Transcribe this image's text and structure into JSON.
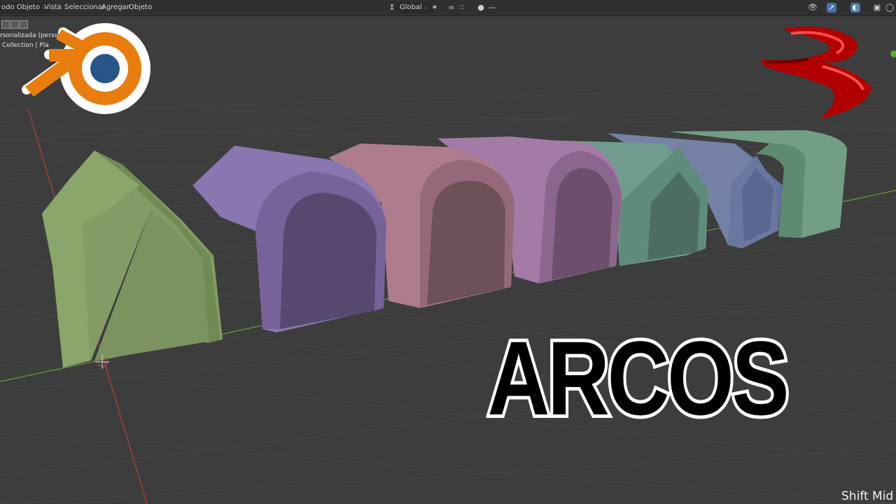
{
  "header": {
    "mode_label": "odo Objeto",
    "menus": [
      "Vista",
      "Seleccionar",
      "Agregar",
      "Objeto"
    ],
    "transform_orientation": "Global"
  },
  "hud": {
    "view_name": "rsonalizada (perso",
    "collection_info": "Collection | Pla"
  },
  "overlay": {
    "title": "ARCOS",
    "shortcut_hint": "Shift Mid"
  },
  "icons": [
    "blender-logo",
    "red-s-logo",
    "eye-icon",
    "select-icon",
    "overlay-icon",
    "shading-icon",
    "snap-icon",
    "proportional-icon",
    "cursor-icon"
  ],
  "colors": {
    "background": "#3d3d3d",
    "grid": "#464646",
    "x_axis": "#b5423f",
    "y_axis": "#6b9b36",
    "arch_green": "#839c66",
    "arch_purple": "#8a76b0",
    "arch_pink": "#ad7d8e",
    "arch_magenta": "#a47aa6",
    "arch_teal": "#6f9c8e",
    "arch_blue": "#7582a6",
    "arch_green2": "#719e84",
    "blender_orange": "#e87d0d",
    "blender_blue": "#265787",
    "logo_red": "#c00000"
  }
}
